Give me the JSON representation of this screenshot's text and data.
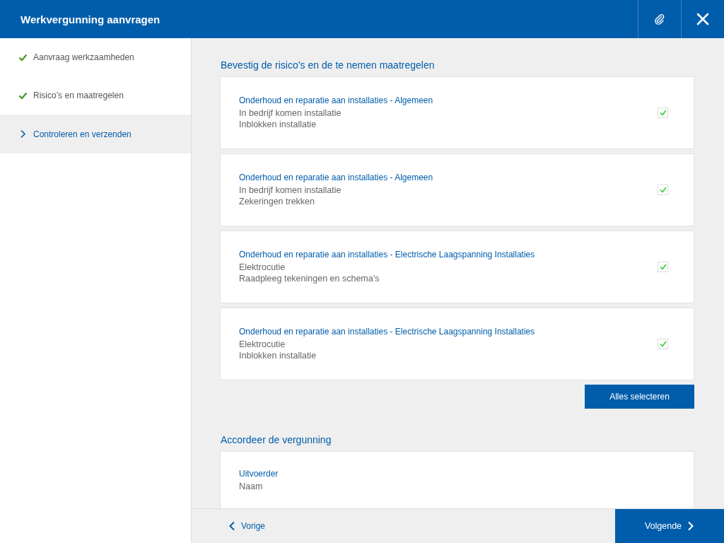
{
  "window": {
    "title": "Werkvergunning aanvragen"
  },
  "sidebar": {
    "items": [
      {
        "label": "Aanvraag werkzaamheden",
        "kind": "done",
        "selected": false
      },
      {
        "label": "Risico’s en maatregelen",
        "kind": "done",
        "selected": false
      },
      {
        "label": "Controleren en verzenden",
        "kind": "current",
        "selected": true
      }
    ]
  },
  "risks": {
    "heading": "Bevestig de risico’s en de te nemen maatregelen",
    "items": [
      {
        "title": "Onderhoud en reparatie aan installaties - Algemeen",
        "risk": "In bedrijf komen installatie",
        "measure": "Inblokken installatie",
        "checked": true
      },
      {
        "title": "Onderhoud en reparatie aan installaties - Algemeen",
        "risk": "In bedrijf komen installatie",
        "measure": "Zekeringen trekken",
        "checked": true
      },
      {
        "title": "Onderhoud en reparatie aan installaties - Electrische Laagspanning Installaties",
        "risk": "Elektrocutie",
        "measure": "Raadpleeg tekeningen en schema’s",
        "checked": true
      },
      {
        "title": "Onderhoud en reparatie aan installaties - Electrische Laagspanning Installaties",
        "risk": "Elektrocutie",
        "measure": "Inblokken installatie",
        "checked": true
      }
    ],
    "select_all_button": "Alles selecteren"
  },
  "approval": {
    "heading": "Accordeer de vergunning",
    "label": "Uitvoerder",
    "value": "Naam"
  },
  "footer": {
    "previous": "Vorige",
    "next": "Volgende"
  }
}
